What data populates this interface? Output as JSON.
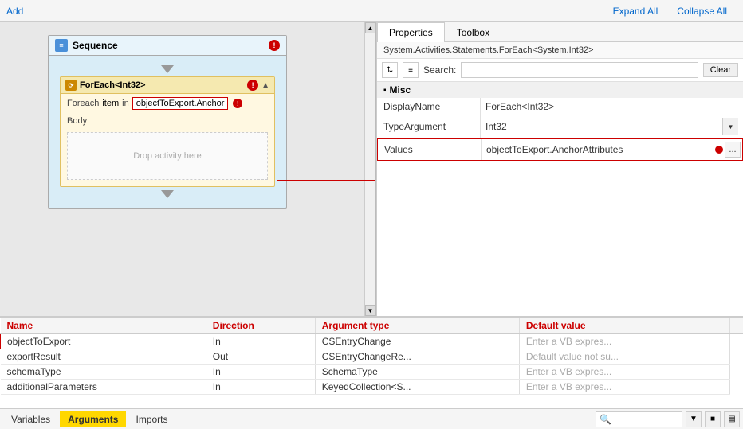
{
  "toolbar": {
    "add_label": "Add",
    "expand_all_label": "Expand All",
    "collapse_all_label": "Collapse All"
  },
  "tabs": {
    "properties_label": "Properties",
    "toolbox_label": "Toolbox"
  },
  "properties_pane": {
    "type_label": "System.Activities.Statements.ForEach<System.Int32>",
    "search_label": "Search:",
    "search_placeholder": "",
    "clear_label": "Clear",
    "section_misc": "Misc",
    "display_name_label": "DisplayName",
    "display_name_value": "ForEach<Int32>",
    "type_argument_label": "TypeArgument",
    "type_argument_value": "Int32",
    "values_label": "Values",
    "values_value": "objectToExport.AnchorAttributes"
  },
  "sequence": {
    "title": "Sequence",
    "error_icon": "!"
  },
  "foreach": {
    "title": "ForEach<Int32>",
    "foreach_label": "Foreach",
    "item_label": "item",
    "in_label": "in",
    "value": "objectToExport.Anchor",
    "body_label": "Body",
    "drop_label": "Drop activity here",
    "error_icon": "!"
  },
  "bottom_table": {
    "col_name": "Name",
    "col_direction": "Direction",
    "col_arg_type": "Argument type",
    "col_default": "Default value",
    "rows": [
      {
        "name": "objectToExport",
        "direction": "In",
        "arg_type": "CSEntryChange",
        "default": "Enter a VB expres..."
      },
      {
        "name": "exportResult",
        "direction": "Out",
        "arg_type": "CSEntryChangeRe...",
        "default": "Default value not su..."
      },
      {
        "name": "schemaType",
        "direction": "In",
        "arg_type": "SchemaType",
        "default": "Enter a VB expres..."
      },
      {
        "name": "additionalParameters",
        "direction": "In",
        "arg_type": "KeyedCollection<S...",
        "default": "Enter a VB expres..."
      }
    ]
  },
  "bottom_tabs": {
    "variables_label": "Variables",
    "arguments_label": "Arguments",
    "imports_label": "Imports"
  },
  "icons": {
    "sort_az": "AZ",
    "sort_za": "ZA",
    "expand": "■",
    "collapse": "▲",
    "arrow_down": "▼",
    "ellipsis": "..."
  }
}
